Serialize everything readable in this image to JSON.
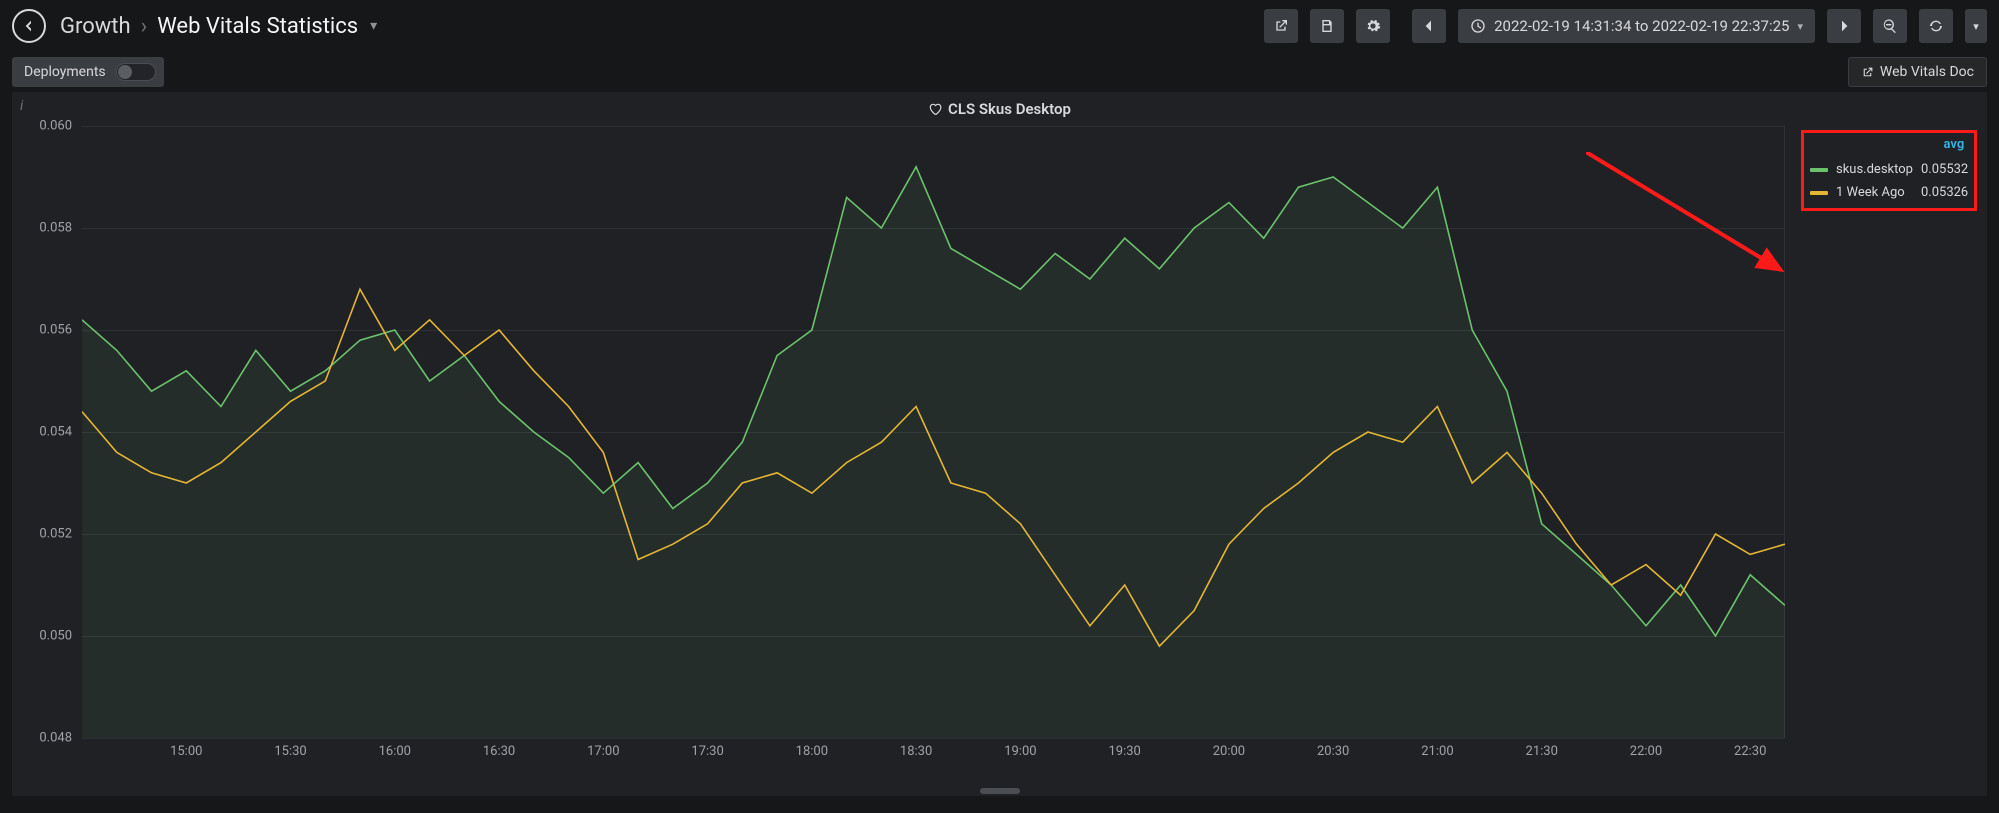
{
  "breadcrumb": {
    "root": "Growth",
    "title": "Web Vitals Statistics"
  },
  "time_range": "2022-02-19 14:31:34 to 2022-02-19 22:37:25",
  "deployments": {
    "label": "Deployments",
    "on": false
  },
  "doc_link": {
    "label": "Web Vitals Doc"
  },
  "panel": {
    "title": "CLS Skus Desktop"
  },
  "legend": {
    "header": "avg",
    "rows": [
      {
        "name": "skus.desktop",
        "color": "#6cc26c",
        "value": "0.05532"
      },
      {
        "name": "1 Week Ago",
        "color": "#e5b636",
        "value": "0.05326"
      }
    ]
  },
  "chart_data": {
    "type": "line",
    "title": "CLS Skus Desktop",
    "xlabel": "",
    "ylabel": "",
    "ylim": [
      0.048,
      0.06
    ],
    "y_ticks": [
      0.048,
      0.05,
      0.052,
      0.054,
      0.056,
      0.058,
      0.06
    ],
    "x_ticks": [
      "15:00",
      "15:30",
      "16:00",
      "16:30",
      "17:00",
      "17:30",
      "18:00",
      "18:30",
      "19:00",
      "19:30",
      "20:00",
      "20:30",
      "21:00",
      "21:30",
      "22:00",
      "22:30"
    ],
    "x": [
      "14:31",
      "14:40",
      "14:50",
      "15:00",
      "15:10",
      "15:20",
      "15:30",
      "15:40",
      "15:50",
      "16:00",
      "16:10",
      "16:20",
      "16:30",
      "16:40",
      "16:50",
      "17:00",
      "17:10",
      "17:20",
      "17:30",
      "17:40",
      "17:50",
      "18:00",
      "18:10",
      "18:20",
      "18:30",
      "18:40",
      "18:50",
      "19:00",
      "19:10",
      "19:20",
      "19:30",
      "19:40",
      "19:50",
      "20:00",
      "20:10",
      "20:20",
      "20:30",
      "20:40",
      "20:50",
      "21:00",
      "21:10",
      "21:20",
      "21:30",
      "21:40",
      "21:50",
      "22:00",
      "22:10",
      "22:20",
      "22:30",
      "22:37"
    ],
    "series": [
      {
        "name": "skus.desktop",
        "color": "#6cc26c",
        "avg": 0.05532,
        "values": [
          0.0562,
          0.0556,
          0.0548,
          0.0552,
          0.0545,
          0.0556,
          0.0548,
          0.0552,
          0.0558,
          0.056,
          0.055,
          0.0555,
          0.0546,
          0.054,
          0.0535,
          0.0528,
          0.0534,
          0.0525,
          0.053,
          0.0538,
          0.0555,
          0.056,
          0.0586,
          0.058,
          0.0592,
          0.0576,
          0.0572,
          0.0568,
          0.0575,
          0.057,
          0.0578,
          0.0572,
          0.058,
          0.0585,
          0.0578,
          0.0588,
          0.059,
          0.0585,
          0.058,
          0.0588,
          0.056,
          0.0548,
          0.0522,
          0.0516,
          0.051,
          0.0502,
          0.051,
          0.05,
          0.0512,
          0.0506
        ]
      },
      {
        "name": "1 Week Ago",
        "color": "#e5b636",
        "avg": 0.05326,
        "values": [
          0.0544,
          0.0536,
          0.0532,
          0.053,
          0.0534,
          0.054,
          0.0546,
          0.055,
          0.0568,
          0.0556,
          0.0562,
          0.0555,
          0.056,
          0.0552,
          0.0545,
          0.0536,
          0.0515,
          0.0518,
          0.0522,
          0.053,
          0.0532,
          0.0528,
          0.0534,
          0.0538,
          0.0545,
          0.053,
          0.0528,
          0.0522,
          0.0512,
          0.0502,
          0.051,
          0.0498,
          0.0505,
          0.0518,
          0.0525,
          0.053,
          0.0536,
          0.054,
          0.0538,
          0.0545,
          0.053,
          0.0536,
          0.0528,
          0.0518,
          0.051,
          0.0514,
          0.0508,
          0.052,
          0.0516,
          0.0518
        ]
      }
    ]
  }
}
